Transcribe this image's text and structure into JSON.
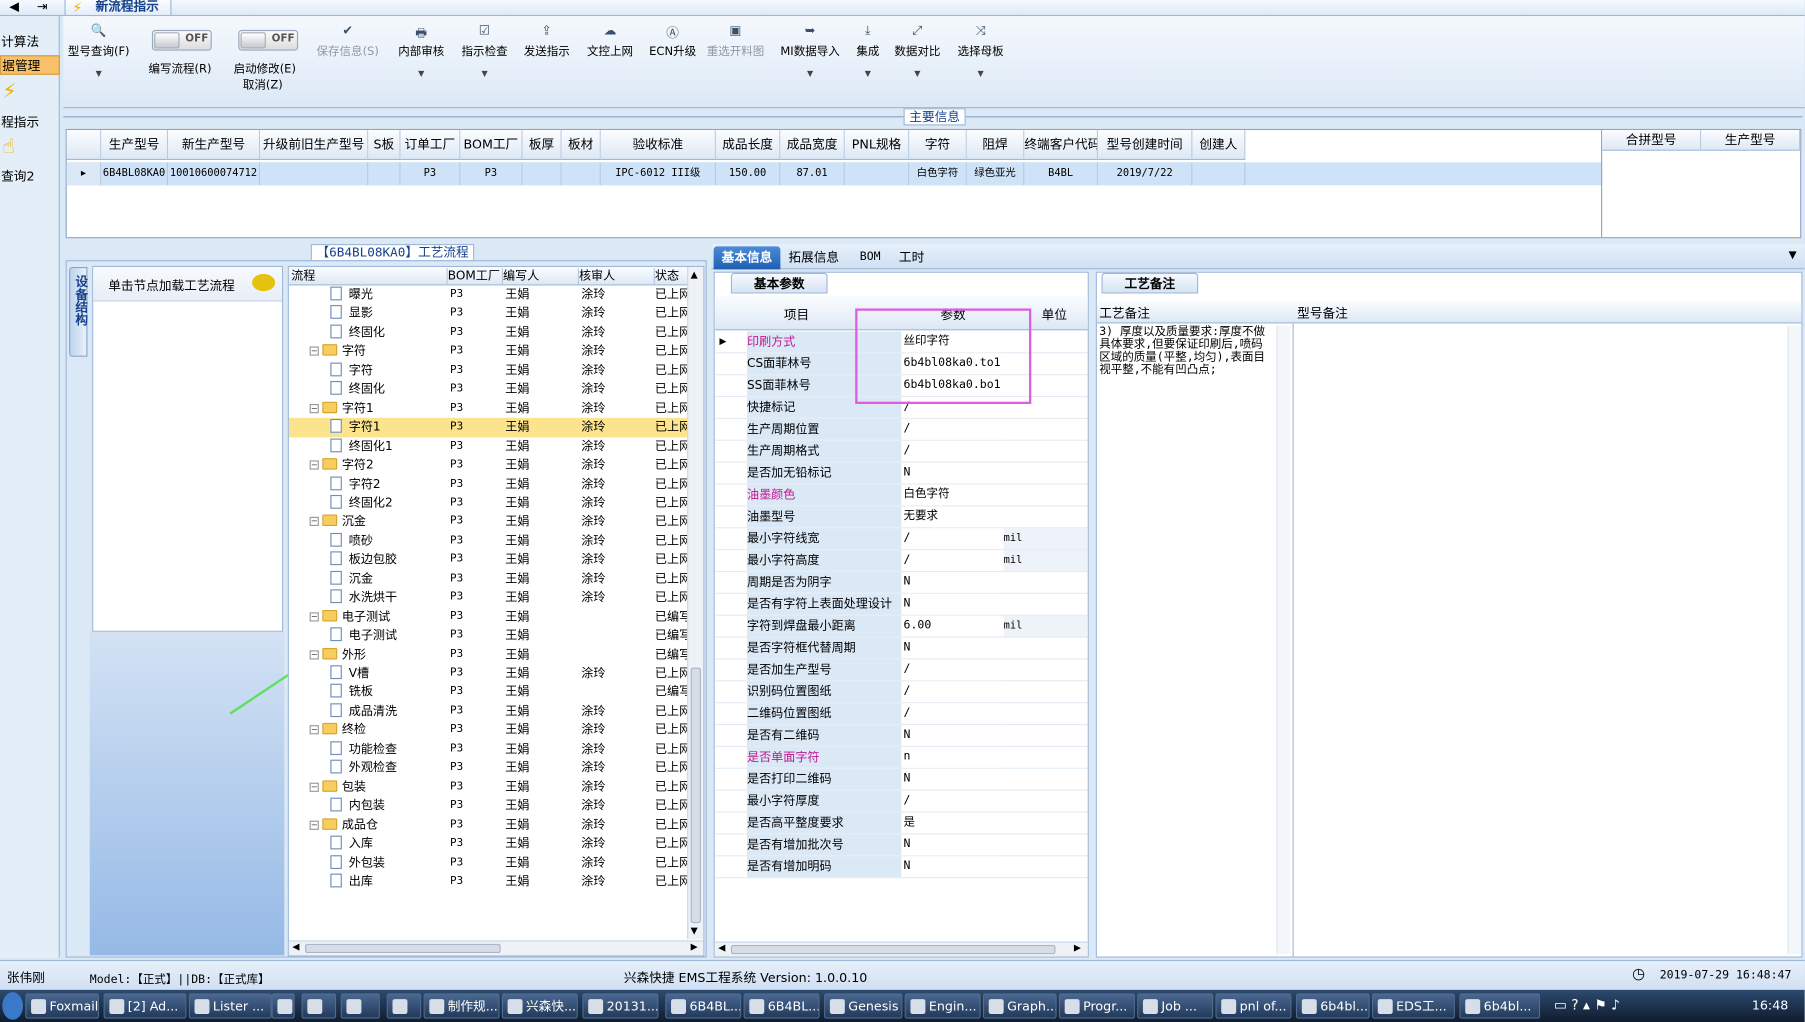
{
  "window": {
    "tab_title": "新流程指示"
  },
  "left_nav": [
    "计算法",
    "据管理",
    "程指示",
    "查询2"
  ],
  "toolbar": {
    "buttons": [
      {
        "label": "型号查询(F)",
        "icon": "search-icon",
        "disabled": false
      },
      {
        "label": "保存信息(S)",
        "icon": "check-icon",
        "disabled": true
      },
      {
        "label": "内部审核",
        "icon": "printer-icon",
        "disabled": false
      },
      {
        "label": "指示检查",
        "icon": "check-doc-icon",
        "disabled": false
      },
      {
        "label": "发送指示",
        "icon": "upload-icon",
        "disabled": false
      },
      {
        "label": "文控上网",
        "icon": "cloud-upload-icon",
        "disabled": false
      },
      {
        "label": "ECN升级",
        "icon": "ecn-icon",
        "disabled": false
      },
      {
        "label": "重选开料图",
        "icon": "image-icon",
        "disabled": true
      },
      {
        "label": "MI数据导入",
        "icon": "import-icon",
        "disabled": false
      },
      {
        "label": "集成",
        "icon": "download-icon",
        "disabled": false
      },
      {
        "label": "数据对比",
        "icon": "compare-icon",
        "disabled": false
      },
      {
        "label": "选择母板",
        "icon": "shuffle-icon",
        "disabled": false
      }
    ],
    "toggle_state": "OFF",
    "write_flow_label": "编写流程(R)",
    "start_modify_label": "启动修改(E)",
    "cancel_label": "取消(Z)"
  },
  "main_info": {
    "title": "主要信息",
    "columns": [
      "生产型号",
      "新生产型号",
      "升级前旧生产型号",
      "S板",
      "订单工厂",
      "BOM工厂",
      "板厚",
      "板材",
      "验收标准",
      "成品长度",
      "成品宽度",
      "PNL规格",
      "字符",
      "阻焊",
      "终端客户代码",
      "型号创建时间",
      "创建人"
    ],
    "rows": [
      [
        "6B4BL08KA0",
        "10010600074712",
        "",
        "",
        "P3",
        "P3",
        "",
        "",
        "IPC-6012 III级",
        "150.00",
        "87.01",
        "",
        "白色字符",
        "绿色亚光",
        "B4BL",
        "2019/7/22",
        ""
      ]
    ],
    "side_columns": [
      "合拼型号",
      "生产型号"
    ]
  },
  "flow_panel": {
    "title": "【6B4BL08KA0】工艺流程",
    "side_tab": "设备结构",
    "load_hint": "单击节点加载工艺流程",
    "columns": [
      "流程",
      "BOM工厂",
      "编写人",
      "核审人",
      "状态"
    ],
    "rows": [
      {
        "name": "曝光",
        "level": 1,
        "bom": "P3",
        "writer": "王娟",
        "reviewer": "涂玲",
        "status": "已上网"
      },
      {
        "name": "显影",
        "level": 1,
        "bom": "P3",
        "writer": "王娟",
        "reviewer": "涂玲",
        "status": "已上网"
      },
      {
        "name": "终固化",
        "level": 1,
        "bom": "P3",
        "writer": "王娟",
        "reviewer": "涂玲",
        "status": "已上网"
      },
      {
        "name": "字符",
        "level": 0,
        "bom": "P3",
        "writer": "王娟",
        "reviewer": "涂玲",
        "status": "已上网"
      },
      {
        "name": "字符",
        "level": 1,
        "bom": "P3",
        "writer": "王娟",
        "reviewer": "涂玲",
        "status": "已上网"
      },
      {
        "name": "终固化",
        "level": 1,
        "bom": "P3",
        "writer": "王娟",
        "reviewer": "涂玲",
        "status": "已上网"
      },
      {
        "name": "字符1",
        "level": 0,
        "bom": "P3",
        "writer": "王娟",
        "reviewer": "涂玲",
        "status": "已上网"
      },
      {
        "name": "字符1",
        "level": 1,
        "bom": "P3",
        "writer": "王娟",
        "reviewer": "涂玲",
        "status": "已上网",
        "selected": true
      },
      {
        "name": "终固化1",
        "level": 1,
        "bom": "P3",
        "writer": "王娟",
        "reviewer": "涂玲",
        "status": "已上网"
      },
      {
        "name": "字符2",
        "level": 0,
        "bom": "P3",
        "writer": "王娟",
        "reviewer": "涂玲",
        "status": "已上网"
      },
      {
        "name": "字符2",
        "level": 1,
        "bom": "P3",
        "writer": "王娟",
        "reviewer": "涂玲",
        "status": "已上网"
      },
      {
        "name": "终固化2",
        "level": 1,
        "bom": "P3",
        "writer": "王娟",
        "reviewer": "涂玲",
        "status": "已上网"
      },
      {
        "name": "沉金",
        "level": 0,
        "bom": "P3",
        "writer": "王娟",
        "reviewer": "涂玲",
        "status": "已上网"
      },
      {
        "name": "喷砂",
        "level": 1,
        "bom": "P3",
        "writer": "王娟",
        "reviewer": "涂玲",
        "status": "已上网"
      },
      {
        "name": "板边包胶",
        "level": 1,
        "bom": "P3",
        "writer": "王娟",
        "reviewer": "涂玲",
        "status": "已上网"
      },
      {
        "name": "沉金",
        "level": 1,
        "bom": "P3",
        "writer": "王娟",
        "reviewer": "涂玲",
        "status": "已上网"
      },
      {
        "name": "水洗烘干",
        "level": 1,
        "bom": "P3",
        "writer": "王娟",
        "reviewer": "涂玲",
        "status": "已上网"
      },
      {
        "name": "电子测试",
        "level": 0,
        "bom": "P3",
        "writer": "王娟",
        "reviewer": "",
        "status": "已编写"
      },
      {
        "name": "电子测试",
        "level": 1,
        "bom": "P3",
        "writer": "王娟",
        "reviewer": "",
        "status": "已编写"
      },
      {
        "name": "外形",
        "level": 0,
        "bom": "P3",
        "writer": "王娟",
        "reviewer": "",
        "status": "已编写"
      },
      {
        "name": "V槽",
        "level": 1,
        "bom": "P3",
        "writer": "王娟",
        "reviewer": "涂玲",
        "status": "已上网"
      },
      {
        "name": "铣板",
        "level": 1,
        "bom": "P3",
        "writer": "王娟",
        "reviewer": "",
        "status": "已编写"
      },
      {
        "name": "成品清洗",
        "level": 1,
        "bom": "P3",
        "writer": "王娟",
        "reviewer": "涂玲",
        "status": "已上网"
      },
      {
        "name": "终检",
        "level": 0,
        "bom": "P3",
        "writer": "王娟",
        "reviewer": "涂玲",
        "status": "已上网"
      },
      {
        "name": "功能检查",
        "level": 1,
        "bom": "P3",
        "writer": "王娟",
        "reviewer": "涂玲",
        "status": "已上网"
      },
      {
        "name": "外观检查",
        "level": 1,
        "bom": "P3",
        "writer": "王娟",
        "reviewer": "涂玲",
        "status": "已上网"
      },
      {
        "name": "包装",
        "level": 0,
        "bom": "P3",
        "writer": "王娟",
        "reviewer": "涂玲",
        "status": "已上网"
      },
      {
        "name": "内包装",
        "level": 1,
        "bom": "P3",
        "writer": "王娟",
        "reviewer": "涂玲",
        "status": "已上网"
      },
      {
        "name": "成品仓",
        "level": 0,
        "bom": "P3",
        "writer": "王娟",
        "reviewer": "涂玲",
        "status": "已上网"
      },
      {
        "name": "入库",
        "level": 1,
        "bom": "P3",
        "writer": "王娟",
        "reviewer": "涂玲",
        "status": "已上网"
      },
      {
        "name": "外包装",
        "level": 1,
        "bom": "P3",
        "writer": "王娟",
        "reviewer": "涂玲",
        "status": "已上网"
      },
      {
        "name": "出库",
        "level": 1,
        "bom": "P3",
        "writer": "王娟",
        "reviewer": "涂玲",
        "status": "已上网"
      }
    ]
  },
  "right_tabs": [
    "基本信息",
    "拓展信息",
    "BOM",
    "工时"
  ],
  "params": {
    "title": "基本参数",
    "columns": [
      "项目",
      "参数",
      "单位"
    ],
    "rows": [
      {
        "item": "印刷方式",
        "value": "丝印字符",
        "unit": "",
        "highlight": true
      },
      {
        "item": "CS面菲林号",
        "value": "6b4bl08ka0.to1",
        "unit": ""
      },
      {
        "item": "SS面菲林号",
        "value": "6b4bl08ka0.bo1",
        "unit": ""
      },
      {
        "item": "快捷标记",
        "value": "/",
        "unit": ""
      },
      {
        "item": "生产周期位置",
        "value": "/",
        "unit": ""
      },
      {
        "item": "生产周期格式",
        "value": "/",
        "unit": ""
      },
      {
        "item": "是否加无铅标记",
        "value": "N",
        "unit": ""
      },
      {
        "item": "油墨颜色",
        "value": "白色字符",
        "unit": "",
        "highlight": true
      },
      {
        "item": "油墨型号",
        "value": "无要求",
        "unit": ""
      },
      {
        "item": "最小字符线宽",
        "value": "/",
        "unit": "mil"
      },
      {
        "item": "最小字符高度",
        "value": "/",
        "unit": "mil"
      },
      {
        "item": "周期是否为阴字",
        "value": "N",
        "unit": ""
      },
      {
        "item": "是否有字符上表面处理设计",
        "value": "N",
        "unit": ""
      },
      {
        "item": "字符到焊盘最小距离",
        "value": "6.00",
        "unit": "mil"
      },
      {
        "item": "是否字符框代替周期",
        "value": "N",
        "unit": ""
      },
      {
        "item": "是否加生产型号",
        "value": "/",
        "unit": ""
      },
      {
        "item": "识别码位置图纸",
        "value": "/",
        "unit": ""
      },
      {
        "item": "二维码位置图纸",
        "value": "/",
        "unit": ""
      },
      {
        "item": "是否有二维码",
        "value": "N",
        "unit": ""
      },
      {
        "item": "是否单面字符",
        "value": "n",
        "unit": "",
        "highlight": true
      },
      {
        "item": "是否打印二维码",
        "value": "N",
        "unit": ""
      },
      {
        "item": "最小字符厚度",
        "value": "/",
        "unit": ""
      },
      {
        "item": "是否高平整度要求",
        "value": "是",
        "unit": ""
      },
      {
        "item": "是否有增加批次号",
        "value": "N",
        "unit": ""
      },
      {
        "item": "是否有增加明码",
        "value": "N",
        "unit": ""
      }
    ]
  },
  "remarks": {
    "title": "工艺备注",
    "col1": "工艺备注",
    "col2": "型号备注",
    "text": "3)    厚度以及质量要求:厚度不做具体要求,但要保证印刷后,喷码区域的质量(平整,均匀),表面目视平整,不能有凹凸点;"
  },
  "status_bar": {
    "user": "张伟刚",
    "model": "Model:【正式】||DB:【正式库】",
    "system": "兴森快捷 EMS工程系统 Version: 1.0.0.10",
    "datetime": "2019-07-29 16:48:47"
  },
  "taskbar": {
    "items": [
      "Foxmail",
      "[2] Ad...",
      "Lister ...",
      "制作规...",
      "兴森快...",
      "20131...",
      "6B4BL...",
      "6B4BL...",
      "Genesis",
      "Engin...",
      "Graph...",
      "Progr...",
      "Job ...",
      "pnl of...",
      "6b4bl...",
      "EDS工...",
      "6b4bl..."
    ],
    "time": "16:48"
  }
}
